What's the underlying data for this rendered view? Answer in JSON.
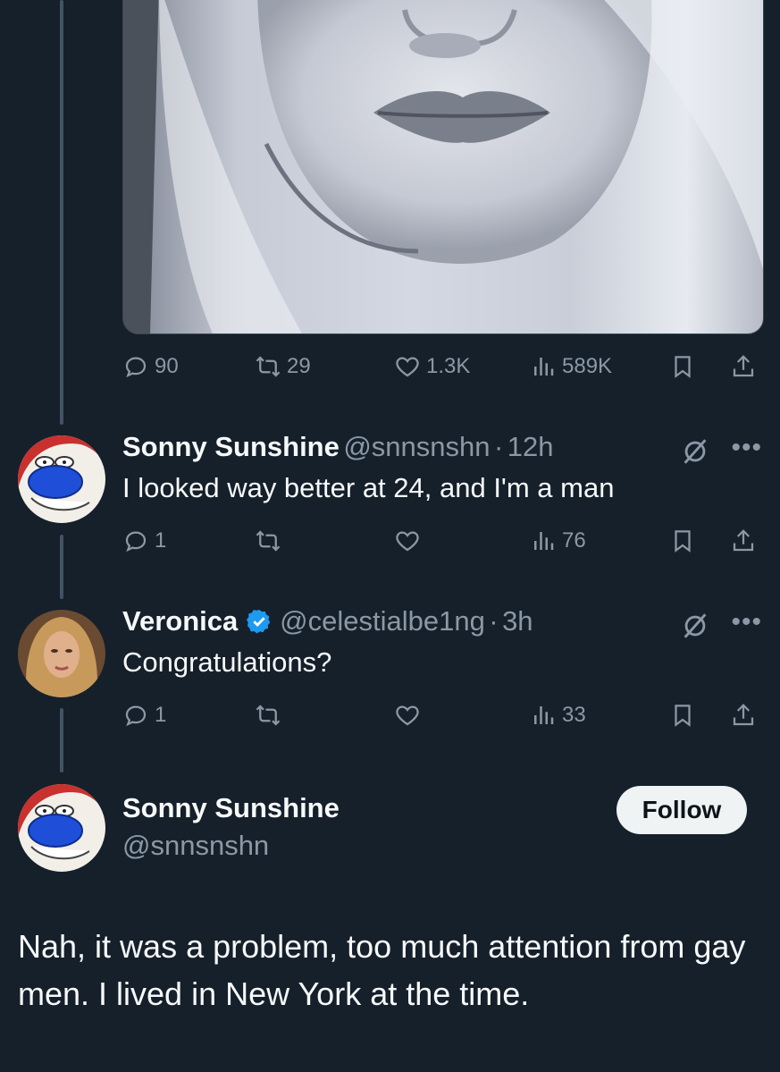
{
  "colors": {
    "background": "#15202b",
    "text": "#f7f9f9",
    "muted": "#8b98a5",
    "verified": "#1d9bf0",
    "follow_bg": "#eff3f4"
  },
  "top_post": {
    "stats": {
      "replies": "90",
      "reposts": "29",
      "likes": "1.3K",
      "views": "589K"
    }
  },
  "replies": [
    {
      "name": "Sonny Sunshine",
      "handle": "@snnsnshn",
      "sep": "·",
      "time": "12h",
      "text": "I looked way better at 24, and I'm a man",
      "stats": {
        "replies": "1",
        "reposts": "",
        "likes": "",
        "views": "76"
      },
      "verified": false,
      "avatar_icon": "cartoon-character-avatar"
    },
    {
      "name": "Veronica",
      "handle": "@celestialbe1ng",
      "sep": "·",
      "time": "3h",
      "text": "Congratulations?",
      "stats": {
        "replies": "1",
        "reposts": "",
        "likes": "",
        "views": "33"
      },
      "verified": true,
      "avatar_icon": "portrait-photo-avatar"
    }
  ],
  "main_post": {
    "name": "Sonny Sunshine",
    "handle": "@snnsnshn",
    "follow_label": "Follow",
    "text": "Nah, it was a problem, too much attention from gay men.  I lived in New York at the time."
  },
  "icons": {
    "reply": "reply-icon",
    "repost": "repost-icon",
    "like": "heart-icon",
    "views": "views-icon",
    "bookmark": "bookmark-icon",
    "share": "share-icon",
    "grok": "grok-icon",
    "more": "more-icon"
  }
}
